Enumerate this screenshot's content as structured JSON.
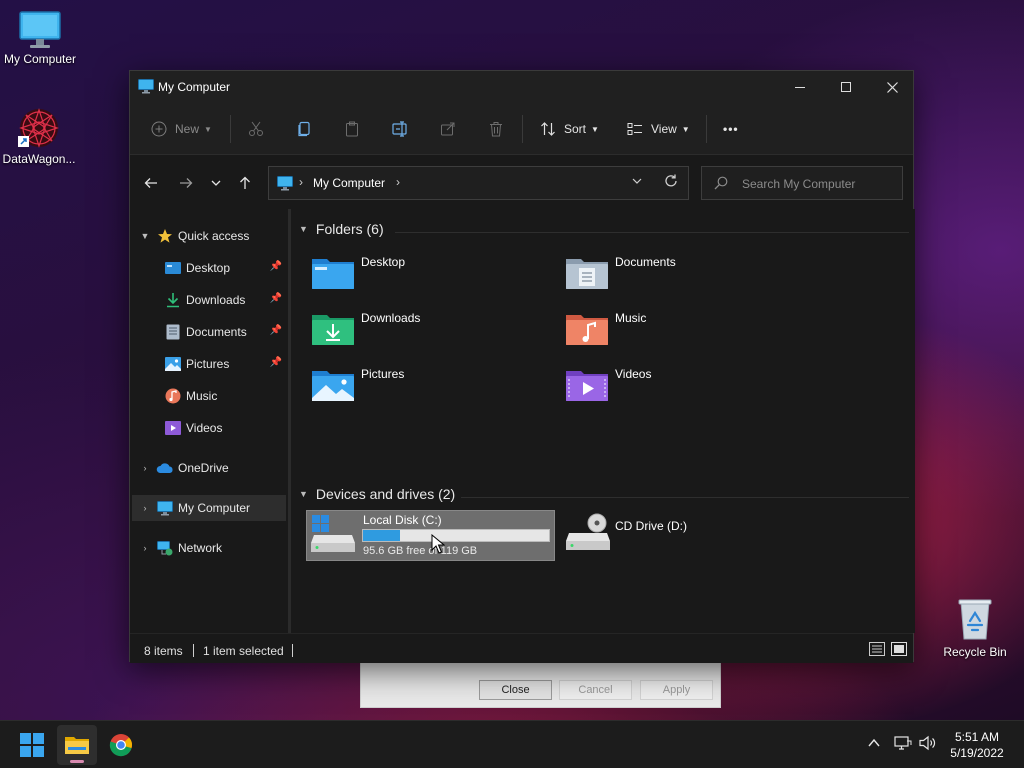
{
  "desktop": {
    "icons": [
      {
        "label": "My Computer"
      },
      {
        "label": "DataWagon..."
      },
      {
        "label": "Recycle Bin"
      }
    ]
  },
  "background_dialog": {
    "buttons": {
      "close": "Close",
      "cancel": "Cancel",
      "apply": "Apply"
    }
  },
  "window": {
    "title": "My Computer",
    "controls": {
      "minimize": "—",
      "maximize": "☐",
      "close": "✕"
    }
  },
  "toolbar": {
    "new_label": "New",
    "sort_label": "Sort",
    "view_label": "View",
    "more_label": "•••"
  },
  "navigation": {
    "breadcrumb": "My Computer",
    "search_placeholder": "Search My Computer"
  },
  "sidebar": {
    "quick_access": "Quick access",
    "items": [
      {
        "label": "Desktop",
        "pinned": true
      },
      {
        "label": "Downloads",
        "pinned": true
      },
      {
        "label": "Documents",
        "pinned": true
      },
      {
        "label": "Pictures",
        "pinned": true
      },
      {
        "label": "Music",
        "pinned": false
      },
      {
        "label": "Videos",
        "pinned": false
      }
    ],
    "onedrive": "OneDrive",
    "my_computer": "My Computer",
    "network": "Network"
  },
  "content": {
    "folders_header": "Folders (6)",
    "folders": [
      {
        "name": "Desktop"
      },
      {
        "name": "Documents"
      },
      {
        "name": "Downloads"
      },
      {
        "name": "Music"
      },
      {
        "name": "Pictures"
      },
      {
        "name": "Videos"
      }
    ],
    "devices_header": "Devices and drives (2)",
    "drives": [
      {
        "name": "Local Disk (C:)",
        "free_text": "95.6 GB free of 119 GB",
        "used_fraction": 0.197
      },
      {
        "name": "CD Drive (D:)"
      }
    ]
  },
  "status": {
    "items": "8 items",
    "selected": "1 item selected"
  },
  "taskbar": {
    "time": "5:51 AM",
    "date": "5/19/2022"
  },
  "colors": {
    "accent": "#2f9be0",
    "window_bg": "#191919",
    "selection": "#6e6e6e"
  }
}
